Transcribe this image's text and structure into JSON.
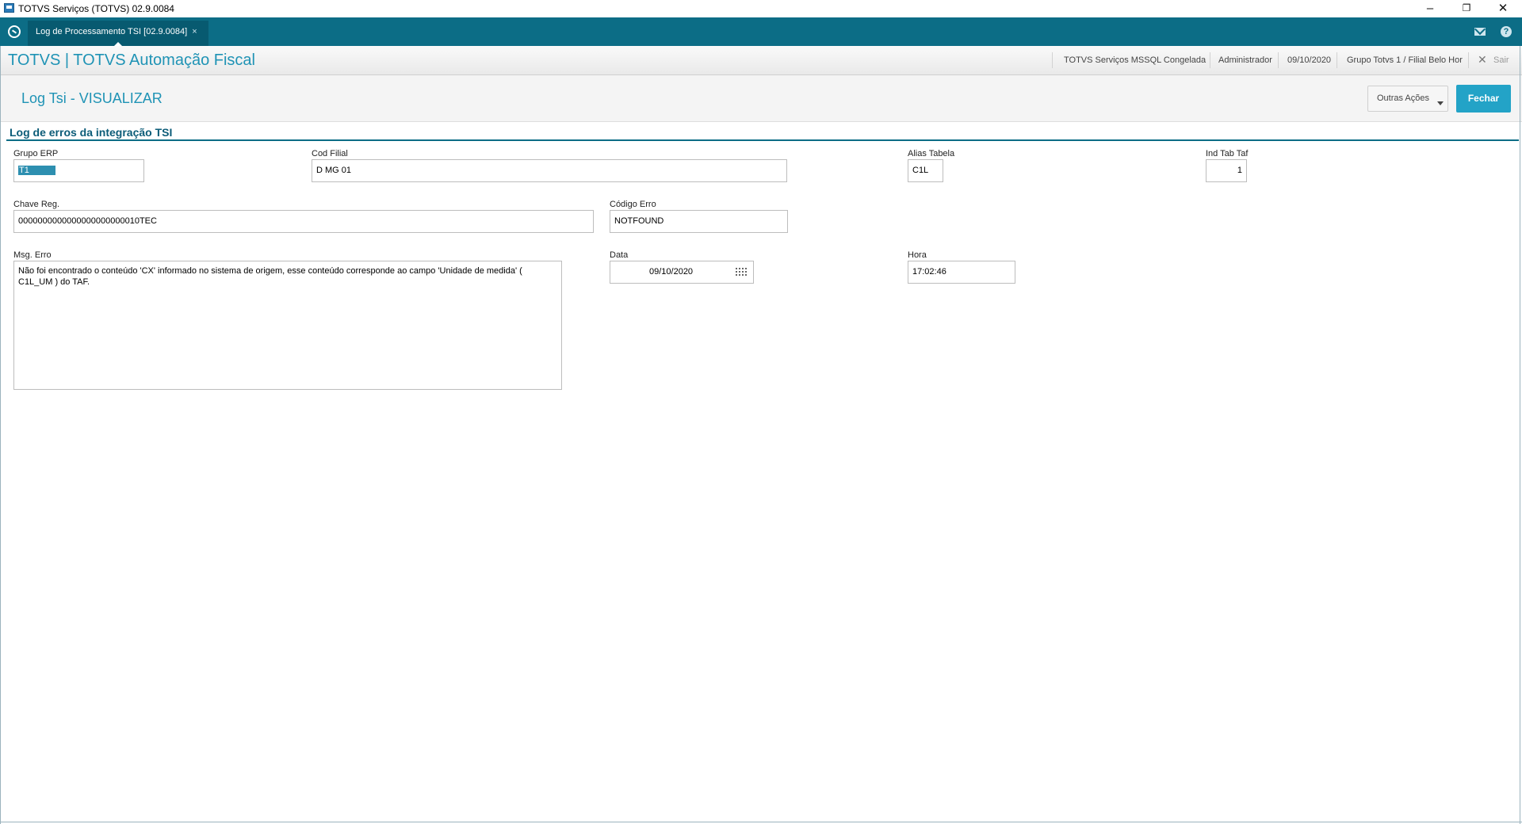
{
  "window": {
    "title": "TOTVS Serviços (TOTVS) 02.9.0084"
  },
  "tabbar": {
    "tabs": [
      {
        "label": "Log de Processamento TSI [02.9.0084]",
        "close": "×"
      }
    ]
  },
  "header": {
    "app_title": "TOTVS | TOTVS Automação Fiscal",
    "environment": "TOTVS Serviços MSSQL Congelada",
    "user": "Administrador",
    "date": "09/10/2020",
    "company": "Grupo Totvs 1 / Filial Belo Hor",
    "exit_label": "Sair"
  },
  "page": {
    "title": "Log Tsi - VISUALIZAR",
    "other_actions": "Outras Ações",
    "close_button": "Fechar"
  },
  "section": {
    "title": "Log de erros da integração TSI"
  },
  "fields": {
    "grupo_erp": {
      "label": "Grupo ERP",
      "value": "T1"
    },
    "cod_filial": {
      "label": "Cod Filial",
      "value": "D MG 01"
    },
    "alias_tabela": {
      "label": "Alias Tabela",
      "value": "C1L"
    },
    "ind_tab_taf": {
      "label": "Ind Tab Taf",
      "value": "1"
    },
    "chave_reg": {
      "label": "Chave Reg.",
      "value": "0000000000000000000000010TEC"
    },
    "codigo_erro": {
      "label": "Código Erro",
      "value": "NOTFOUND"
    },
    "msg_erro": {
      "label": "Msg. Erro",
      "value": "Não foi encontrado o conteúdo 'CX' informado no sistema de origem, esse conteúdo corresponde ao campo 'Unidade de medida' ( C1L_UM ) do TAF."
    },
    "data": {
      "label": "Data",
      "value": "09/10/2020"
    },
    "hora": {
      "label": "Hora",
      "value": "17:02:46"
    }
  },
  "icons": [
    "app-icon",
    "home-icon",
    "mail-icon",
    "help-icon",
    "close-icon",
    "calendar-icon"
  ],
  "colors": {
    "teal_bar": "#0c6d86",
    "accent": "#1f93b5",
    "primary_button": "#23a3c7"
  }
}
